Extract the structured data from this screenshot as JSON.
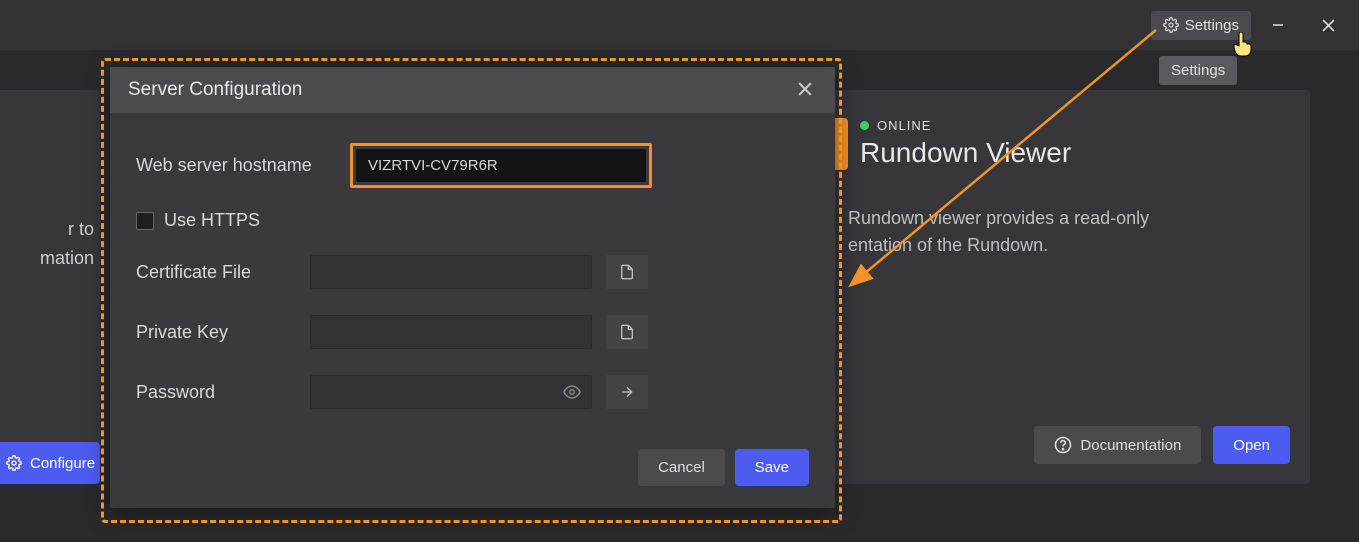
{
  "titlebar": {
    "settings_label": "Settings"
  },
  "tooltip": {
    "text": "Settings"
  },
  "left_card": {
    "line1": "r to",
    "line2": "mation",
    "configure_label": "Configure"
  },
  "right_card": {
    "status": "ONLINE",
    "title": "Rundown Viewer",
    "desc": "Rundown viewer provides a read-only\nentation of the Rundown.",
    "documentation_label": "Documentation",
    "open_label": "Open"
  },
  "dialog": {
    "title": "Server Configuration",
    "hostname_label": "Web server hostname",
    "hostname_value": "VIZRTVI-CV79R6R",
    "use_https_label": "Use HTTPS",
    "cert_label": "Certificate File",
    "key_label": "Private Key",
    "password_label": "Password",
    "cancel_label": "Cancel",
    "save_label": "Save"
  }
}
